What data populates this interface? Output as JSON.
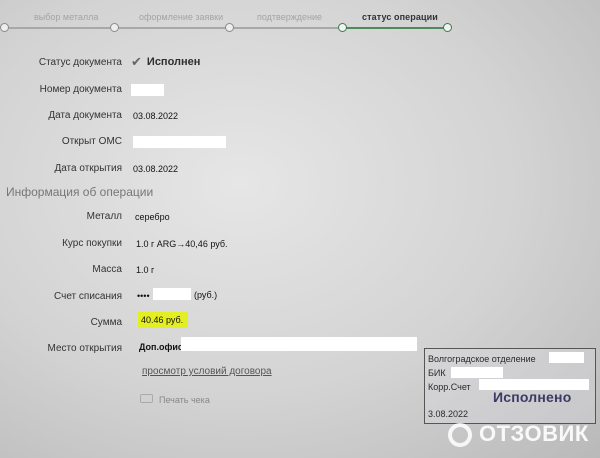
{
  "stepper": {
    "steps": [
      "выбор металла",
      "оформление заявки",
      "подтверждение",
      "статус операции"
    ],
    "active_index": 3
  },
  "document": {
    "status_label": "Статус документа",
    "status_value": "Исполнен",
    "number_label": "Номер документа",
    "date_label": "Дата документа",
    "date_value": "03.08.2022",
    "oms_label": "Открыт ОМС",
    "open_date_label": "Дата открытия",
    "open_date_value": "03.08.2022"
  },
  "operation": {
    "section_title": "Информация об операции",
    "metal_label": "Металл",
    "metal_value": "серебро",
    "rate_label": "Курс покупки",
    "rate_value": "1.0 г  ARG→40,46  руб.",
    "mass_label": "Масса",
    "mass_value": "1.0  г",
    "account_label": "Счет списания",
    "account_prefix": "••••",
    "account_suffix": "(руб.)",
    "sum_label": "Сумма",
    "sum_value": "40.46 руб.",
    "place_label": "Место открытия",
    "place_value": "Доп.офис"
  },
  "actions": {
    "contract_link": "просмотр условий договора",
    "print_label": "Печать чека"
  },
  "stamp": {
    "line1": "Волгоградское отделение",
    "line2": "БИК",
    "line3": "Корр.Счет",
    "status": "Исполнено",
    "date": "3.08.2022"
  },
  "watermark": {
    "text": "ОТЗОВИК"
  },
  "colors": {
    "accent": "#4c8a5c",
    "highlight": "#e3ef22",
    "stamp_ink": "#3a3a66"
  }
}
